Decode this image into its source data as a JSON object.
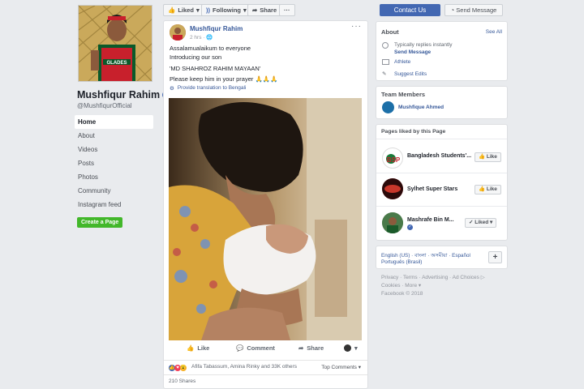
{
  "page": {
    "name": "Mushfiqur Rahim",
    "handle": "@MushfiqurOfficial",
    "cover_jersey_text": "GLADES"
  },
  "left_nav": {
    "items": [
      "Home",
      "About",
      "Videos",
      "Posts",
      "Photos",
      "Community",
      "Instagram feed"
    ],
    "create_page": "Create a Page"
  },
  "top_bar": {
    "liked": "Liked",
    "following": "Following",
    "share": "Share",
    "more": "···",
    "contact": "Contact Us",
    "send_message": "Send Message"
  },
  "post": {
    "author": "Mushfiqur Rahim",
    "time": "2 hrs ·",
    "lines": [
      "Assalamualaikum to everyone",
      "Introducing our son",
      "'MD SHAHROZ RAHIM MAYAAN'",
      "Please keep him in your prayer 🙏🙏🙏"
    ],
    "translate": "Provide translation to Bengali",
    "actions": {
      "like": "Like",
      "comment": "Comment",
      "share": "Share"
    },
    "reactions_text": "Afifa Tabassum, Amina Rinky and 33K others",
    "top_comments": "Top Comments ▾",
    "shares": "210 Shares"
  },
  "about": {
    "title": "About",
    "see_all": "See All",
    "replies": "Typically replies instantly",
    "send_message": "Send Message",
    "category": "Athlete",
    "suggest": "Suggest Edits"
  },
  "team": {
    "title": "Team Members",
    "member": "Mushfique Ahmed"
  },
  "liked_pages": {
    "title": "Pages liked by this Page",
    "pages": [
      {
        "name": "Bangladesh Students'...",
        "button": "Like"
      },
      {
        "name": "Sylhet Super Stars",
        "button": "Like"
      },
      {
        "name": "Mashrafe Bin M...",
        "button": "Liked ▾"
      }
    ]
  },
  "languages": {
    "line1": "English (US) · বাংলা · অসমীয়া · Español",
    "line2": "Português (Brasil)",
    "plus": "+"
  },
  "footer": {
    "line1": "Privacy · Terms · Advertising · Ad Choices ▷",
    "line2": "Cookies · More ▾",
    "line3": "Facebook © 2018"
  },
  "colors": {
    "brand": "#4267b2",
    "link": "#365899",
    "create": "#42b72a",
    "background": "#e9ebee"
  }
}
